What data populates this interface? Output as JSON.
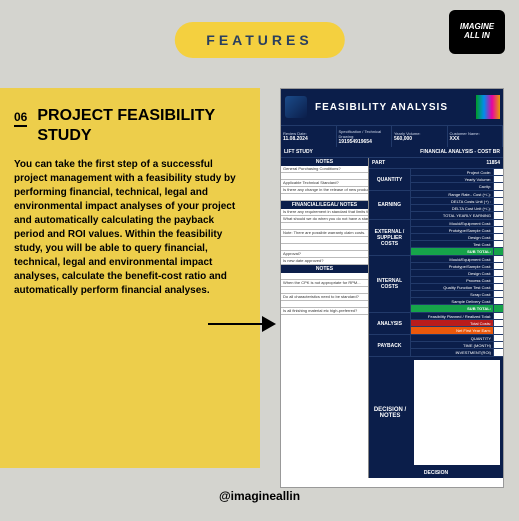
{
  "logo": {
    "line1": "IMAGINE",
    "line2": "ALL IN"
  },
  "features_label": "FEATURES",
  "number": "06",
  "title": "PROJECT FEASIBILITY STUDY",
  "body": "You can take the first step of a successful project management with a feasibility study by performing financial, technical, legal and environmental impact analyses of your project and automatically calculating the payback period and ROI values. Within the feasibility study, you will be able to query financial, technical, legal and environmental impact analyses, calculate the benefit-cost ratio and automatically perform financial analyses.",
  "handle": "@imagineallin",
  "doc": {
    "title": "FEASIBILITY ANALYSIS",
    "info": {
      "review_date_label": "Review Date:",
      "review_date": "11.08.2024",
      "spec_label": "Specification / Technical Drawing:",
      "spec": "191954919654",
      "volume_label": "Yearly Volume:",
      "volume": "560,000",
      "customer_label": "Customer Name:",
      "customer": "XXX"
    },
    "left_header1": "LIFT STUDY",
    "right_header": "FINANCIAL ANALYSIS - COST BR",
    "notes_label": "NOTES",
    "part_label": "PART",
    "part_no": "11854",
    "sections": {
      "quantity": {
        "label": "QUANTITY",
        "rows": [
          "Project Code:",
          "Yearly Volume:",
          "Cavity:"
        ]
      },
      "earning": {
        "label": "EARNING",
        "rows": [
          "Range Rate.. Cost (+/-):",
          "DELTA Costs Unit (+) :",
          "DELTA Cost Unit (+/-):",
          "TOTAL YEARLY EARNING"
        ]
      },
      "external": {
        "label": "EXTERNAL / SUPPLIER COSTS",
        "rows": [
          "Mould/Equipment Cost:",
          "Prototype/Sample Cost:",
          "Design Cost:",
          "Test Cost:"
        ],
        "subtotal": "SUB TOTAL:"
      },
      "internal": {
        "label": "INTERNAL COSTS",
        "rows": [
          "Mould/Equipment Cost:",
          "Prototype/Sample Cost:",
          "Design Cost:",
          "Process Cost:",
          "Quality Function Test Cost:",
          "Scrap Cost:",
          "Sample Delivery Cost:"
        ],
        "subtotal": "SUB TOTAL:"
      },
      "analysis": {
        "label": "ANALYSIS",
        "rows": [
          "Feasibility Planned / Realized     Total:",
          "Total Costs:",
          "Net First Year Earn:"
        ]
      },
      "payback": {
        "label": "PAYBACK",
        "rows": [
          "QUANTITY",
          "TIME (MONTH)",
          "INVESTMENT(ROI)"
        ]
      },
      "decision": {
        "label": "DECISION / NOTES",
        "footer": "DECISION"
      }
    },
    "left_notes_header2": "FINANCIAL/LEGAL/ NOTES",
    "left_notes": [
      "General Purchasing Conditions?",
      "",
      "Applicable Technical Standard?",
      "Is there any change in the release of new product/material standards used?",
      "",
      "Is there any requirement in standard that limits the...",
      "What should we do when you do not have a standard?",
      "",
      "Note: There are possible warranty claim costs.",
      "",
      "",
      "Approval?",
      "Is new date approved?",
      "",
      "When the CPK is not appropriate for RPM...",
      "",
      "Do all characteristics need to be standard?",
      "",
      "Is all finishing material etc high-preferred?"
    ]
  }
}
